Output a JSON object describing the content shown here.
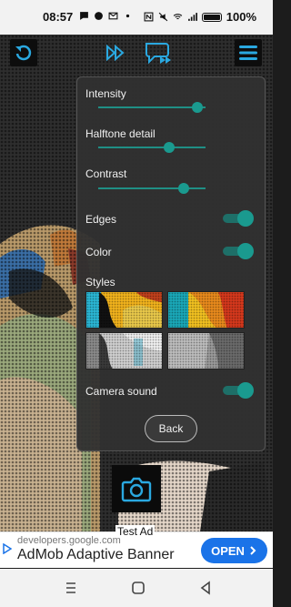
{
  "status_bar": {
    "time": "08:57",
    "battery_percent": "100%"
  },
  "toolbar": {
    "reset_icon": "rotate-ccw-icon",
    "fast_forward_icon": "fast-forward-icon",
    "speech_icon": "speech-bubble-play-icon",
    "menu_icon": "hamburger-menu-icon"
  },
  "settings": {
    "intensity_label": "Intensity",
    "intensity_value": 0.92,
    "halftone_label": "Halftone detail",
    "halftone_value": 0.66,
    "contrast_label": "Contrast",
    "contrast_value": 0.8,
    "edges_label": "Edges",
    "edges_on": true,
    "color_label": "Color",
    "color_on": true,
    "styles_label": "Styles",
    "camera_sound_label": "Camera sound",
    "camera_sound_on": true,
    "back_label": "Back"
  },
  "ad": {
    "test_label": "Test Ad",
    "domain": "developers.google.com",
    "headline": "AdMob Adaptive Banner",
    "button_label": "OPEN"
  },
  "colors": {
    "accent": "#1a9a8f",
    "icon_blue": "#2aa8e0",
    "ad_button": "#1a73e8"
  }
}
